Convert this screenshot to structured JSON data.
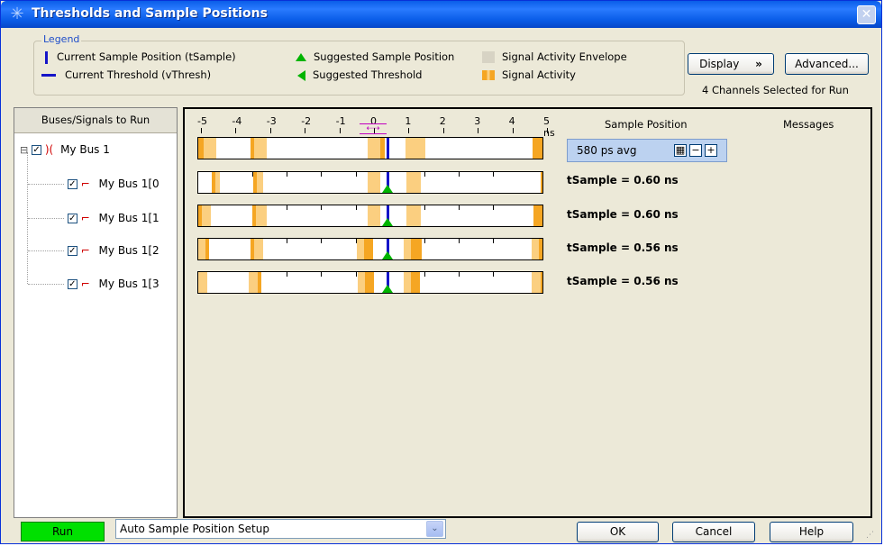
{
  "window": {
    "title": "Thresholds and Sample Positions",
    "close_label": "✕"
  },
  "legend": {
    "title": "Legend",
    "items": [
      {
        "label": "Current Sample Position (tSample)"
      },
      {
        "label": "Current Threshold (vThresh)"
      },
      {
        "label": "Suggested Sample Position"
      },
      {
        "label": "Suggested Threshold"
      },
      {
        "label": "Signal Activity Envelope"
      },
      {
        "label": "Signal Activity"
      }
    ]
  },
  "buttons": {
    "display": "Display",
    "display_arrow": "»",
    "advanced": "Advanced...",
    "ok": "OK",
    "cancel": "Cancel",
    "help": "Help",
    "run": "Run"
  },
  "channels_info": "4 Channels Selected for Run",
  "left_panel": {
    "header": "Buses/Signals to Run",
    "tree": [
      {
        "label": "My Bus 1",
        "expander": "⊟",
        "checked": true
      },
      {
        "label": "My Bus 1[0",
        "checked": true
      },
      {
        "label": "My Bus 1[1",
        "checked": true
      },
      {
        "label": "My Bus 1[2",
        "checked": true
      },
      {
        "label": "My Bus 1[3",
        "checked": true
      }
    ]
  },
  "timeline": {
    "ticks": [
      "-5",
      "-4",
      "-3",
      "-2",
      "-1",
      "0",
      "1",
      "2",
      "3",
      "4",
      "5 ns"
    ]
  },
  "columns": {
    "sample_position": "Sample Position",
    "messages": "Messages"
  },
  "sample_position": {
    "value": "580 ps avg",
    "calc_icon": "▦",
    "minus": "−",
    "plus": "+"
  },
  "channels": [
    {
      "tsample": "tSample =  0.60 ns"
    },
    {
      "tsample": "tSample =  0.60 ns"
    },
    {
      "tsample": "tSample =  0.56 ns"
    },
    {
      "tsample": "tSample =  0.56 ns"
    }
  ],
  "bottom": {
    "setup_mode": "Auto Sample Position Setup",
    "combo_arrow": "⌄"
  },
  "colors": {
    "sample_line": "#1515c8",
    "suggested": "#00b400",
    "activity": "#f5a623",
    "envelope": "#fbcf80",
    "run_button": "#00e000",
    "title_bar": "#0a5de8"
  }
}
